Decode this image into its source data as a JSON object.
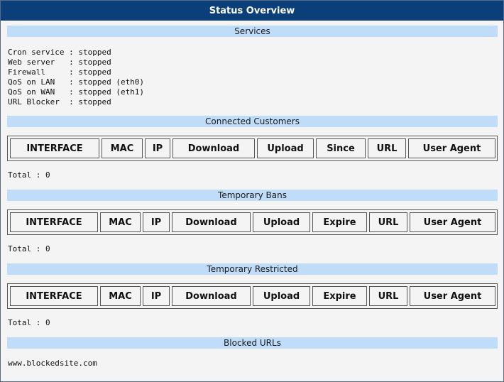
{
  "title": "Status Overview",
  "services": {
    "header": "Services",
    "lines": [
      "Cron service : stopped",
      "Web server   : stopped",
      "Firewall     : stopped",
      "QoS on LAN   : stopped (eth0)",
      "QoS on WAN   : stopped (eth1)",
      "URL Blocker  : stopped"
    ]
  },
  "connected_customers": {
    "header": "Connected Customers",
    "columns": [
      "INTERFACE",
      "MAC",
      "IP",
      "Download",
      "Upload",
      "Since",
      "URL",
      "User Agent"
    ],
    "total": "Total : 0"
  },
  "temporary_bans": {
    "header": "Temporary Bans",
    "columns": [
      "INTERFACE",
      "MAC",
      "IP",
      "Download",
      "Upload",
      "Expire",
      "URL",
      "User Agent"
    ],
    "total": "Total : 0"
  },
  "temporary_restricted": {
    "header": "Temporary Restricted",
    "columns": [
      "INTERFACE",
      "MAC",
      "IP",
      "Download",
      "Upload",
      "Expire",
      "URL",
      "User Agent"
    ],
    "total": "Total : 0"
  },
  "blocked_urls": {
    "header": "Blocked URLs",
    "items": [
      "www.blockedsite.com"
    ]
  }
}
